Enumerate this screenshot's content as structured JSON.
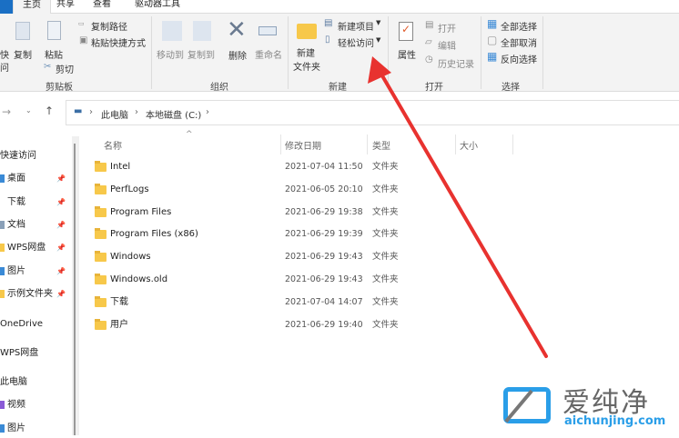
{
  "tabs": [
    "主页",
    "共享",
    "查看",
    "驱动器工具"
  ],
  "ribbon": {
    "clipboard": {
      "partial1": "快",
      "partial2": "问",
      "copy": "复制",
      "paste": "粘贴",
      "copy_path": "复制路径",
      "paste_shortcut": "粘贴快捷方式",
      "cut": "剪切",
      "label": "剪贴板"
    },
    "organize": {
      "move_to": "移动到",
      "copy_to": "复制到",
      "delete": "删除",
      "rename": "重命名",
      "label": "组织"
    },
    "new": {
      "new_folder_1": "新建",
      "new_folder_2": "文件夹",
      "new_item": "新建项目",
      "easy_access": "轻松访问",
      "label": "新建"
    },
    "open": {
      "properties": "属性",
      "open": "打开",
      "edit": "编辑",
      "history": "历史记录",
      "label": "打开"
    },
    "select": {
      "select_all": "全部选择",
      "select_none": "全部取消",
      "invert": "反向选择",
      "label": "选择"
    }
  },
  "breadcrumb": [
    "此电脑",
    "本地磁盘 (C:)"
  ],
  "sidebar": {
    "quick_access": "快速访问",
    "pinned": [
      "桌面",
      "下载",
      "文档",
      "WPS网盘",
      "图片",
      "示例文件夹"
    ],
    "onedrive": "OneDrive",
    "wps": "WPS网盘",
    "this_pc": "此电脑",
    "pc_items": [
      "视频",
      "图片"
    ]
  },
  "columns": {
    "name": "名称",
    "date": "修改日期",
    "type": "类型",
    "size": "大小"
  },
  "files": [
    {
      "name": "Intel",
      "date": "2021-07-04 11:50",
      "type": "文件夹"
    },
    {
      "name": "PerfLogs",
      "date": "2021-06-05 20:10",
      "type": "文件夹"
    },
    {
      "name": "Program Files",
      "date": "2021-06-29 19:38",
      "type": "文件夹"
    },
    {
      "name": "Program Files (x86)",
      "date": "2021-06-29 19:39",
      "type": "文件夹"
    },
    {
      "name": "Windows",
      "date": "2021-06-29 19:43",
      "type": "文件夹"
    },
    {
      "name": "Windows.old",
      "date": "2021-06-29 19:43",
      "type": "文件夹"
    },
    {
      "name": "下载",
      "date": "2021-07-04 14:07",
      "type": "文件夹"
    },
    {
      "name": "用户",
      "date": "2021-06-29 19:40",
      "type": "文件夹"
    }
  ],
  "watermark": {
    "brand": "爱纯净",
    "url": "aichunjing.com"
  },
  "colors": {
    "arrow": "#e8322f",
    "accent": "#1a6fc4",
    "folder": "#f7c84a"
  }
}
